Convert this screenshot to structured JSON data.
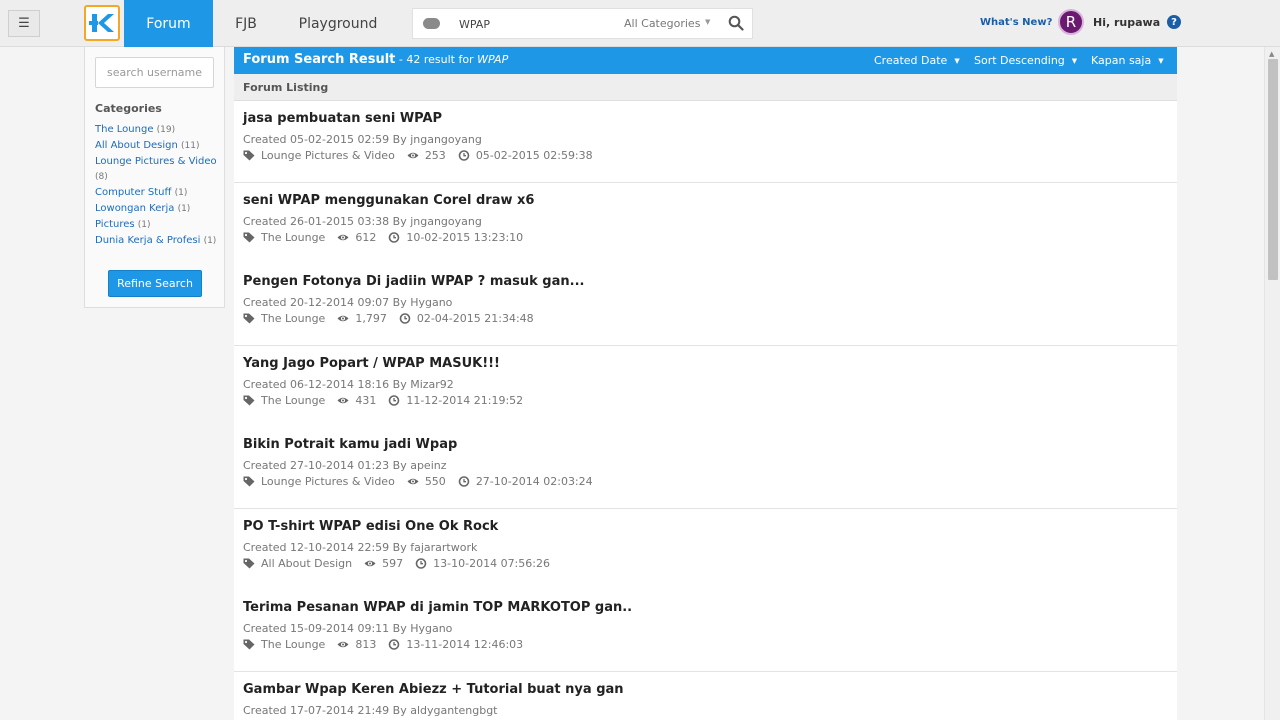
{
  "nav": {
    "forum": "Forum",
    "fjb": "FJB",
    "playground": "Playground",
    "search_value": "WPAP",
    "search_category": "All Categories",
    "whats_new": "What's New?",
    "avatar_letter": "R",
    "greeting": "Hi, rupawa",
    "help": "?",
    "brand_color": "#1e98e6",
    "logo_border_color": "#f5a623"
  },
  "sidebar": {
    "username_placeholder": "search username",
    "categories_title": "Categories",
    "categories": [
      {
        "name": "The Lounge",
        "count": "(19)"
      },
      {
        "name": "All About Design",
        "count": "(11)"
      },
      {
        "name": "Lounge Pictures & Video",
        "count": "(8)"
      },
      {
        "name": "Computer Stuff",
        "count": "(1)"
      },
      {
        "name": "Lowongan Kerja",
        "count": "(1)"
      },
      {
        "name": "Pictures",
        "count": "(1)"
      },
      {
        "name": "Dunia Kerja & Profesi",
        "count": "(1)"
      }
    ],
    "refine_label": "Refine Search"
  },
  "results": {
    "title": "Forum Search Result",
    "subtitle_prefix": " - 42 result for ",
    "query": "WPAP",
    "filters": [
      "Created Date",
      "Sort Descending",
      "Kapan saja"
    ],
    "listing_label": "Forum Listing",
    "items": [
      {
        "title": "jasa pembuatan seni WPAP",
        "meta": "Created 05-02-2015 02:59 By jngangoyang",
        "category": "Lounge Pictures & Video",
        "views": "253",
        "last": "05-02-2015 02:59:38"
      },
      {
        "title": "seni WPAP menggunakan Corel draw x6",
        "meta": "Created 26-01-2015 03:38 By jngangoyang",
        "category": "The Lounge",
        "views": "612",
        "last": "10-02-2015 13:23:10"
      },
      {
        "title": "Pengen Fotonya Di jadiin WPAP ? masuk gan...",
        "meta": "Created 20-12-2014 09:07 By Hygano",
        "category": "The Lounge",
        "views": "1,797",
        "last": "02-04-2015 21:34:48"
      },
      {
        "title": "Yang Jago Popart / WPAP MASUK!!!",
        "meta": "Created 06-12-2014 18:16 By Mizar92",
        "category": "The Lounge",
        "views": "431",
        "last": "11-12-2014 21:19:52"
      },
      {
        "title": "Bikin Potrait kamu jadi Wpap",
        "meta": "Created 27-10-2014 01:23 By apeinz",
        "category": "Lounge Pictures & Video",
        "views": "550",
        "last": "27-10-2014 02:03:24"
      },
      {
        "title": "PO T-shirt WPAP edisi One Ok Rock",
        "meta": "Created 12-10-2014 22:59 By fajarartwork",
        "category": "All About Design",
        "views": "597",
        "last": "13-10-2014 07:56:26"
      },
      {
        "title": "Terima Pesanan WPAP di jamin TOP MARKOTOP gan..",
        "meta": "Created 15-09-2014 09:11 By Hygano",
        "category": "The Lounge",
        "views": "813",
        "last": "13-11-2014 12:46:03"
      },
      {
        "title": "Gambar Wpap Keren Abiezz + Tutorial buat nya gan",
        "meta": "Created 17-07-2014 21:49 By aldygantengbgt",
        "category": "",
        "views": "",
        "last": ""
      }
    ]
  }
}
